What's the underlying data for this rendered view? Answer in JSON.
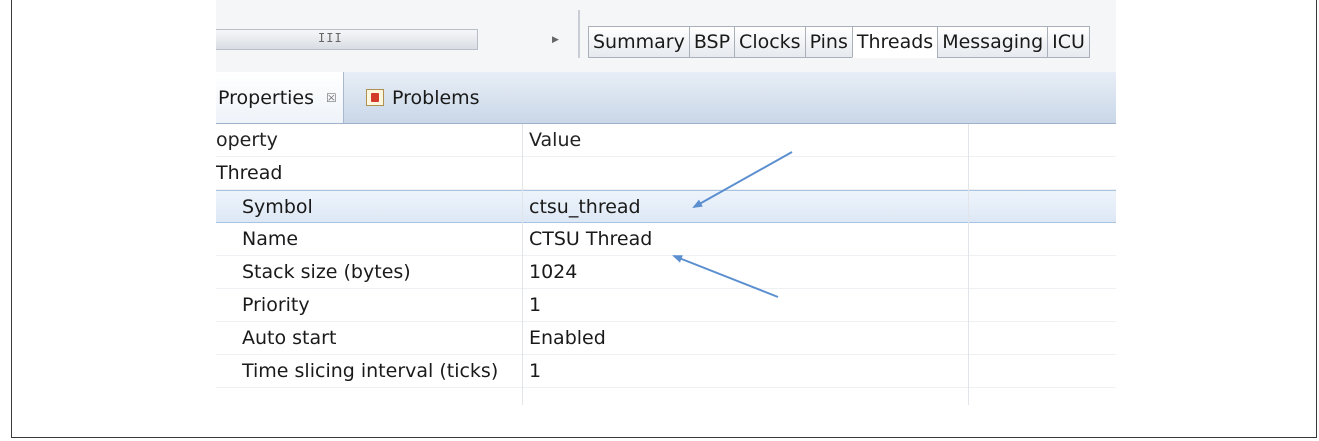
{
  "editor_tabs": [
    "Summary",
    "BSP",
    "Clocks",
    "Pins",
    "Threads",
    "Messaging",
    "ICU"
  ],
  "active_editor_tab": "Threads",
  "scrollbar_grip": "III",
  "view_tabs": {
    "properties": "Properties",
    "properties_close": "☒",
    "problems": "Problems"
  },
  "table": {
    "header": {
      "property": "operty",
      "value": "Value"
    },
    "group": "Thread",
    "rows": [
      {
        "property": "Symbol",
        "value": "ctsu_thread",
        "selected": true
      },
      {
        "property": "Name",
        "value": "CTSU Thread"
      },
      {
        "property": "Stack size (bytes)",
        "value": "1024"
      },
      {
        "property": "Priority",
        "value": "1"
      },
      {
        "property": "Auto start",
        "value": "Enabled"
      },
      {
        "property": "Time slicing interval (ticks)",
        "value": "1"
      }
    ]
  },
  "colors": {
    "arrow": "#5b8fd0",
    "selection": "#dde8f5",
    "view_header": "#c9d7e8"
  }
}
